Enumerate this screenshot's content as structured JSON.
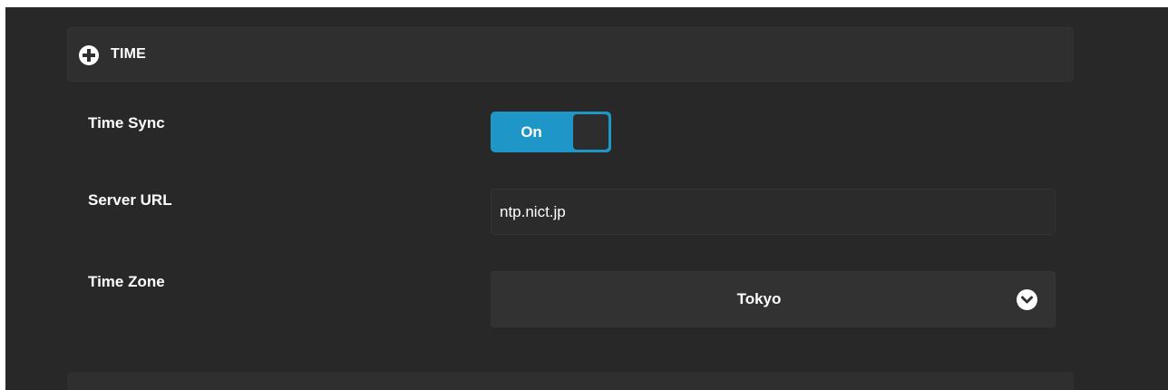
{
  "section": {
    "title": "TIME",
    "expand_icon": "plus-circle-icon"
  },
  "fields": {
    "time_sync": {
      "label": "Time Sync",
      "toggle_text": "On",
      "state": true
    },
    "server_url": {
      "label": "Server URL",
      "value": "ntp.nict.jp"
    },
    "time_zone": {
      "label": "Time Zone",
      "selected": "Tokyo",
      "dropdown_icon": "chevron-down-circle-icon"
    }
  },
  "colors": {
    "background": "#282828",
    "header": "#2f2f2f",
    "toggle_on": "#1e97c8",
    "text": "#ffffff"
  }
}
